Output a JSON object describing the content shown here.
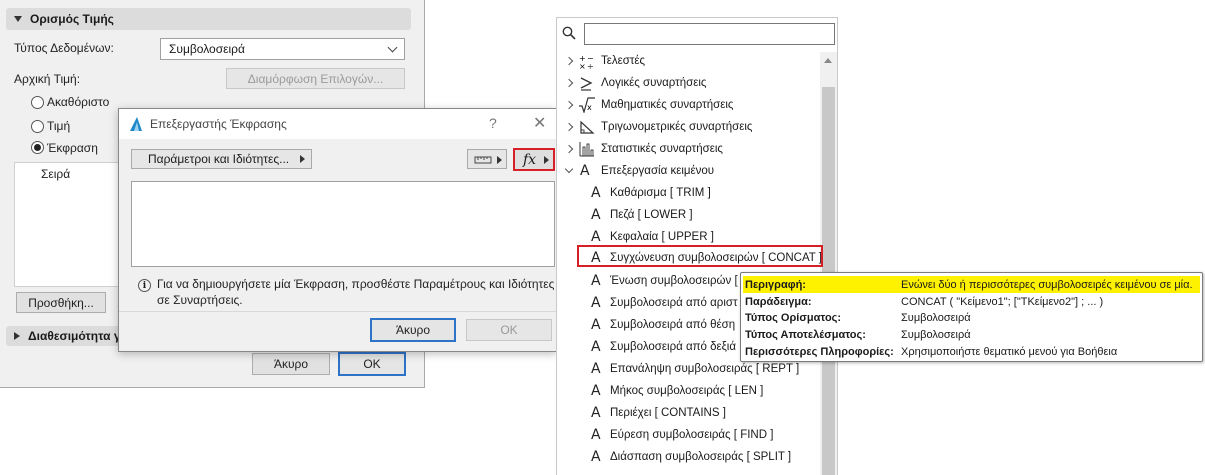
{
  "settings_panel": {
    "section_value": "Ορισμός Τιμής",
    "data_type_label": "Τύπος Δεδομένων:",
    "data_type_value": "Συμβολοσειρά",
    "initial_value_label": "Αρχική Τιμή:",
    "config_options_button": "Διαμόρφωση Επιλογών...",
    "radio_undefined": "Ακαθόριστο",
    "radio_value": "Τιμή",
    "radio_expression": "Έκφραση",
    "column_label": "Σειρά",
    "add_button": "Προσθήκη...",
    "section_availability": "Διαθεσιμότητα γ",
    "cancel_button": "Άκυρο",
    "ok_button": "OK"
  },
  "expression_editor": {
    "title": "Επεξεργαστής Έκφρασης",
    "help_symbol": "?",
    "close_symbol": "✕",
    "params_button": "Παράμετροι και Ιδιότητες...",
    "fx_label": "fx",
    "info_text": "Για να δημιουργήσετε μία Έκφραση, προσθέστε Παραμέτρους και Ιδιότητες σε Συναρτήσεις.",
    "cancel_button": "Άκυρο",
    "ok_button": "OK"
  },
  "function_tree": {
    "search_placeholder": "",
    "categories": [
      {
        "label": "Τελεστές",
        "icon": "operators-icon",
        "expanded": false
      },
      {
        "label": "Λογικές συναρτήσεις",
        "icon": "logical-icon",
        "expanded": false
      },
      {
        "label": "Μαθηματικές συναρτήσεις",
        "icon": "math-icon",
        "expanded": false
      },
      {
        "label": "Τριγωνομετρικές συναρτήσεις",
        "icon": "trig-icon",
        "expanded": false
      },
      {
        "label": "Στατιστικές συναρτήσεις",
        "icon": "stats-icon",
        "expanded": false
      },
      {
        "label": "Επεξεργασία κειμένου",
        "icon": "text-icon",
        "expanded": true
      }
    ],
    "text_functions": [
      "Καθάρισμα [ TRIM ]",
      "Πεζά [ LOWER ]",
      "Κεφαλαία [ UPPER ]",
      "Συγχώνευση συμβολοσειρών [ CONCAT ]",
      "Ένωση συμβολοσειρών [",
      "Συμβολοσειρά από αριστ",
      "Συμβολοσειρά από θέση",
      "Συμβολοσειρά από δεξιά",
      "Επανάληψη συμβολοσειράς [ REPT ]",
      "Μήκος συμβολοσειράς [ LEN ]",
      "Περιέχει [ CONTAINS ]",
      "Εύρεση συμβολοσειράς [ FIND ]",
      "Διάσπαση συμβολοσειράς [ SPLIT ]"
    ],
    "function_glyph": "A",
    "selected_index": 3
  },
  "tooltip": {
    "description_label": "Περιγραφή:",
    "description_value": "Ενώνει δύο ή περισσότερες συμβολοσειρές κειμένου σε μία.",
    "example_label": "Παράδειγμα:",
    "example_value": "CONCAT ( \"Κείμενο1\"; [\"ΤΚείμενο2\"] ; ... )",
    "arg_type_label": "Τύπος Ορίσματος:",
    "arg_type_value": "Συμβολοσειρά",
    "result_type_label": "Τύπος Αποτελέσματος:",
    "result_type_value": "Συμβολοσειρά",
    "more_info_label": "Περισσότερες Πληροφορίες:",
    "more_info_value": "Χρησιμοποιήστε θεματικό μενού για Βοήθεια"
  },
  "colors": {
    "highlight_red": "#d61f26",
    "tooltip_highlight": "#fff200",
    "primary_button_border": "#2e73c8"
  }
}
